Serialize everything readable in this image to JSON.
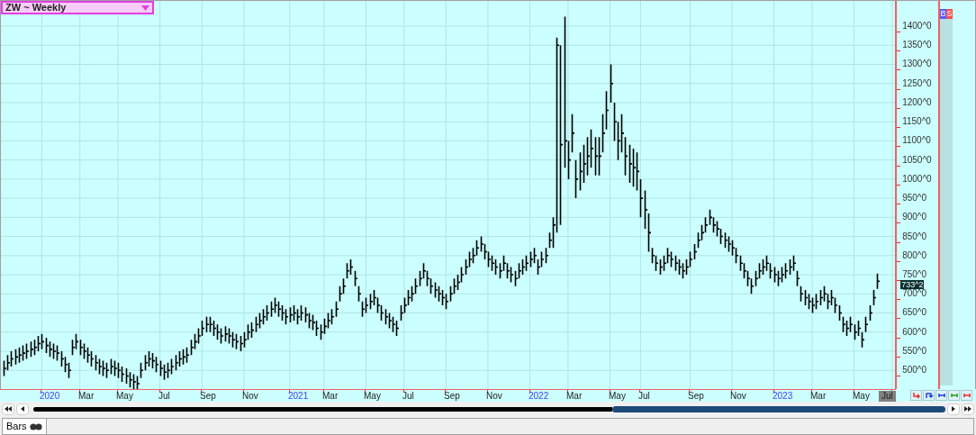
{
  "symbol_selector": {
    "label": "ZW ~ Weekly"
  },
  "chart": {
    "price_axis_labels": [
      "1400^0",
      "1350^0",
      "1300^0",
      "1250^0",
      "1200^0",
      "1150^0",
      "1100^0",
      "1050^0",
      "1000^0",
      "950^0",
      "900^0",
      "850^0",
      "800^0",
      "750^0",
      "700^0",
      "650^0",
      "600^0",
      "550^0",
      "500^0"
    ],
    "date_labels": [
      {
        "label": "2020",
        "kind": "year",
        "current": false
      },
      {
        "label": "Mar",
        "kind": "month",
        "current": false
      },
      {
        "label": "May",
        "kind": "month",
        "current": false
      },
      {
        "label": "Jul",
        "kind": "month",
        "current": false
      },
      {
        "label": "Sep",
        "kind": "month",
        "current": false
      },
      {
        "label": "Nov",
        "kind": "month",
        "current": false
      },
      {
        "label": "2021",
        "kind": "year",
        "current": false
      },
      {
        "label": "Mar",
        "kind": "month",
        "current": false
      },
      {
        "label": "May",
        "kind": "month",
        "current": false
      },
      {
        "label": "Jul",
        "kind": "month",
        "current": false
      },
      {
        "label": "Sep",
        "kind": "month",
        "current": false
      },
      {
        "label": "Nov",
        "kind": "month",
        "current": false
      },
      {
        "label": "2022",
        "kind": "year",
        "current": false
      },
      {
        "label": "Mar",
        "kind": "month",
        "current": false
      },
      {
        "label": "May",
        "kind": "month",
        "current": false
      },
      {
        "label": "Jul",
        "kind": "month",
        "current": false
      },
      {
        "label": "Sep",
        "kind": "month",
        "current": false
      },
      {
        "label": "Nov",
        "kind": "month",
        "current": false
      },
      {
        "label": "2023",
        "kind": "year",
        "current": false
      },
      {
        "label": "Mar",
        "kind": "month",
        "current": false
      },
      {
        "label": "May",
        "kind": "month",
        "current": false
      },
      {
        "label": "Jul",
        "kind": "month",
        "current": true
      }
    ],
    "last_price_label": "733^2"
  },
  "side_buttons": [
    "B",
    "S"
  ],
  "status_bar": {
    "tabs": [
      {
        "label": "Bars",
        "selected": true
      }
    ]
  }
}
